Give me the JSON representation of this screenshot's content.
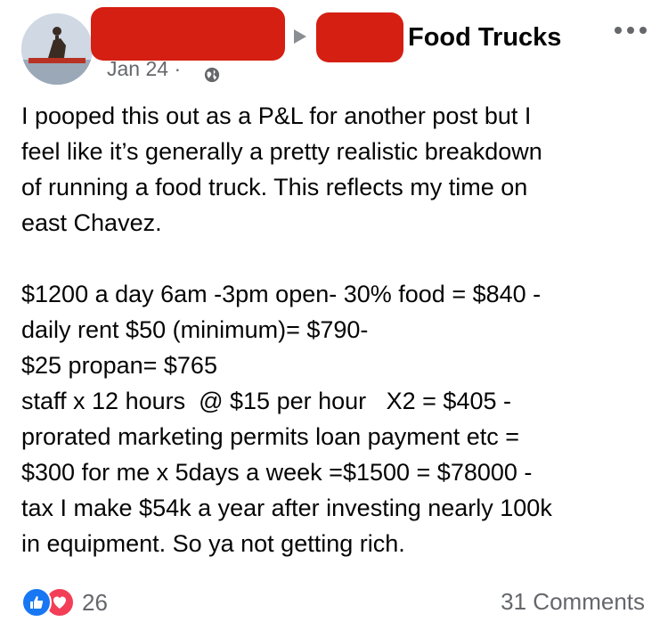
{
  "header": {
    "group_name": "Food Trucks",
    "date": "Jan 24 ·",
    "audience_icon": "globe-icon",
    "more_icon": "more-options-icon"
  },
  "post": {
    "lines": [
      "I pooped this out as a P&L for another post but I",
      "feel like it’s generally a pretty realistic breakdown",
      "of running a food truck. This reflects my time on",
      "east Chavez.",
      "",
      "$1200 a day 6am -3pm open- 30% food = $840 -",
      "daily rent $50 (minimum)= $790-",
      "$25 propan= $765",
      "staff x 12 hours  @ $15 per hour   X2 = $405 -",
      "prorated marketing permits loan payment etc =",
      "$300 for me x 5days a week =$1500 = $78000 -",
      "tax I make $54k a year after investing nearly 100k",
      "in equipment. So ya not getting rich."
    ]
  },
  "footer": {
    "reaction_count": "26",
    "comments_label": "31 Comments",
    "reaction_icons": [
      "like-icon",
      "love-icon"
    ]
  },
  "colors": {
    "text": "#050505",
    "secondary": "#65676b",
    "like_blue": "#1877f2",
    "love_red": "#f33e58",
    "redaction": "#d41f12"
  }
}
